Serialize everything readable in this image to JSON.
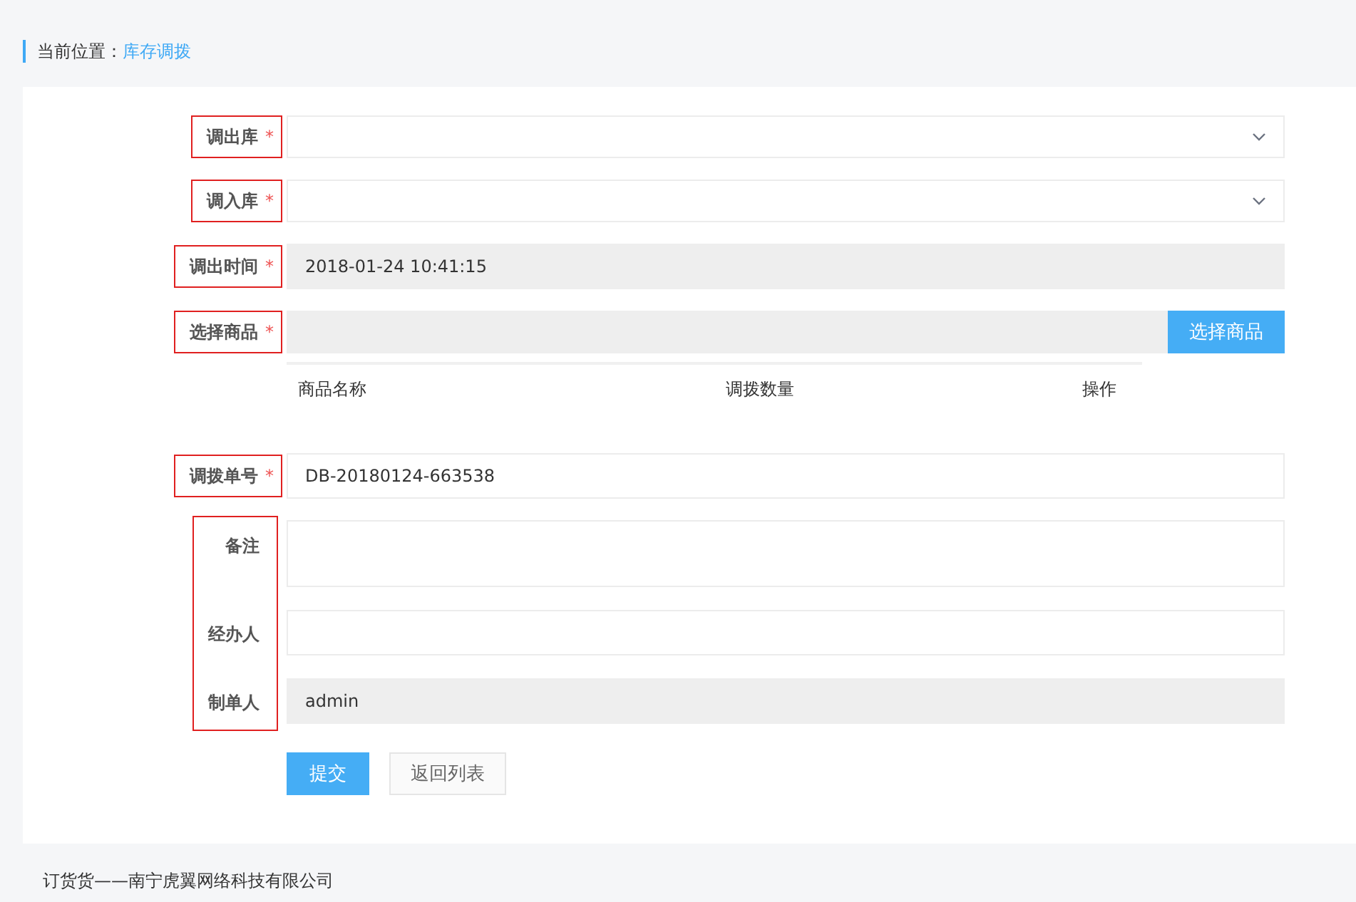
{
  "breadcrumb": {
    "label": "当前位置：",
    "current": "库存调拨"
  },
  "fields": [
    {
      "kind": "select",
      "label": "调出库",
      "required_mark": "*",
      "outlined": true
    },
    {
      "kind": "select",
      "label": "调入库",
      "required_mark": "*",
      "outlined": true
    },
    {
      "kind": "readonly",
      "label": "调出时间",
      "required_mark": "*",
      "outlined": true,
      "value": "2018-01-24 10:41:15"
    },
    {
      "kind": "picker",
      "label": "选择商品",
      "required_mark": "*",
      "outlined": true,
      "button": "选择商品"
    }
  ],
  "goods_table": {
    "columns": [
      "商品名称",
      "调拨数量",
      "操作"
    ]
  },
  "order_field": {
    "label": "调拨单号",
    "required_mark": "*",
    "outlined": true,
    "value": "DB-20180124-663538"
  },
  "extra_fields": {
    "outlined": true,
    "items": [
      {
        "kind": "textarea",
        "label": "备注"
      },
      {
        "kind": "input",
        "label": "经办人"
      },
      {
        "kind": "readonly",
        "label": "制单人",
        "value": "admin"
      }
    ]
  },
  "buttons": [
    {
      "label": "提交",
      "kind": "primary"
    },
    {
      "label": "返回列表",
      "kind": "default"
    }
  ],
  "footer": "订货货——南宁虎翼网络科技有限公司"
}
